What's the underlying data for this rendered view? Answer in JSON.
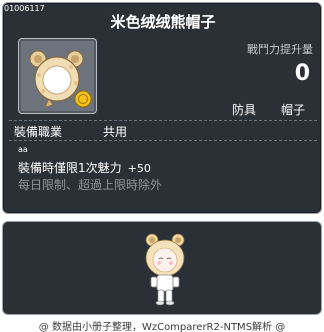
{
  "item": {
    "id": "01006117",
    "name": "米色绒绒熊帽子",
    "icon": "bear-hood-icon"
  },
  "stats": {
    "combat_power_label": "戰鬥力提升量",
    "combat_power_value": "0"
  },
  "tags": {
    "category": "防具",
    "subcategory": "帽子"
  },
  "requirements": {
    "job_label": "裝備職業",
    "job_value": "共用"
  },
  "description": {
    "small_text": "aa",
    "effect": "裝備時僅限1次魅力",
    "bonus": "+50",
    "limit": "每日限制、超過上限時除外"
  },
  "preview": {
    "character": "bear-hood-character-preview"
  },
  "footer": {
    "credit": "@ 数据由小册子整理，WzComparerR2-NTMS解析 @"
  },
  "colors": {
    "panel_bg": "#2b2f36",
    "panel_border": "#9aa1ab",
    "muted_text": "#8e949c",
    "icon_bg": "#6d737c"
  }
}
